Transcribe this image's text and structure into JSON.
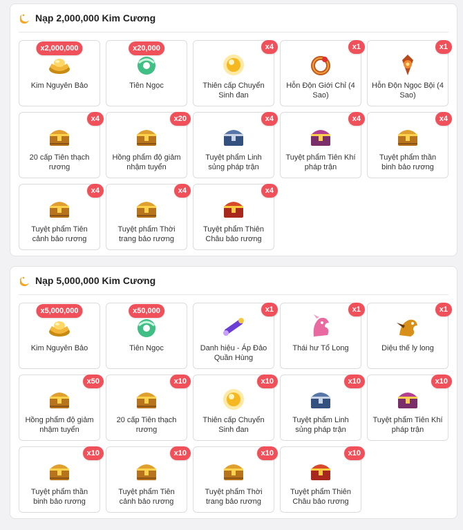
{
  "colors": {
    "badge": "#f0505a",
    "accent": "#f5a623"
  },
  "sections": [
    {
      "title": "Nạp 2,000,000 Kim Cương",
      "items": [
        {
          "name": "Kim Nguyên Bảo",
          "qty": "x2,000,000",
          "icon": "gold-ingot-icon"
        },
        {
          "name": "Tiên Ngọc",
          "qty": "x20,000",
          "icon": "jade-icon"
        },
        {
          "name": "Thiên cấp Chuyển Sinh đan",
          "qty": "x4",
          "icon": "golden-orb-icon"
        },
        {
          "name": "Hỗn Độn Giới Chỉ (4 Sao)",
          "qty": "x1",
          "icon": "ring-icon"
        },
        {
          "name": "Hỗn Độn Ngọc Bội (4 Sao)",
          "qty": "x1",
          "icon": "pendant-icon"
        },
        {
          "name": "20 cấp Tiên thạch rương",
          "qty": "x4",
          "icon": "gold-chest-icon"
        },
        {
          "name": "Hồng phẩm độ giảm nhậm tuyển",
          "qty": "x20",
          "icon": "gold-chest-icon"
        },
        {
          "name": "Tuyệt phẩm Linh sủng pháp trận",
          "qty": "x4",
          "icon": "blue-chest-icon"
        },
        {
          "name": "Tuyệt phẩm Tiên Khí pháp trận",
          "qty": "x4",
          "icon": "purple-chest-icon"
        },
        {
          "name": "Tuyệt phẩm thần binh bảo rương",
          "qty": "x4",
          "icon": "gold-chest-icon"
        },
        {
          "name": "Tuyệt phẩm Tiên cảnh bảo rương",
          "qty": "x4",
          "icon": "gold-chest-icon"
        },
        {
          "name": "Tuyệt phẩm Thời trang bảo rương",
          "qty": "x4",
          "icon": "gold-chest-icon"
        },
        {
          "name": "Tuyệt phẩm Thiên Châu bảo rương",
          "qty": "x4",
          "icon": "red-chest-icon"
        }
      ]
    },
    {
      "title": "Nạp 5,000,000 Kim Cương",
      "items": [
        {
          "name": "Kim Nguyên Bảo",
          "qty": "x5,000,000",
          "icon": "gold-ingot-icon"
        },
        {
          "name": "Tiên Ngọc",
          "qty": "x50,000",
          "icon": "jade-icon"
        },
        {
          "name": "Danh hiệu - Áp Đảo Quần Hùng",
          "qty": "x1",
          "icon": "title-scroll-icon"
        },
        {
          "name": "Thái hư Tổ Long",
          "qty": "x1",
          "icon": "dragon-pink-icon"
        },
        {
          "name": "Diệu thế ly long",
          "qty": "x1",
          "icon": "dragon-gold-icon"
        },
        {
          "name": "Hồng phẩm độ giảm nhậm tuyển",
          "qty": "x50",
          "icon": "gold-chest-icon"
        },
        {
          "name": "20 cấp Tiên thạch rương",
          "qty": "x10",
          "icon": "gold-chest-icon"
        },
        {
          "name": "Thiên cấp Chuyển Sinh đan",
          "qty": "x10",
          "icon": "golden-orb-icon"
        },
        {
          "name": "Tuyệt phẩm Linh sủng pháp trận",
          "qty": "x10",
          "icon": "blue-chest-icon"
        },
        {
          "name": "Tuyệt phẩm Tiên Khí pháp trận",
          "qty": "x10",
          "icon": "purple-chest-icon"
        },
        {
          "name": "Tuyệt phẩm thần binh bảo rương",
          "qty": "x10",
          "icon": "gold-chest-icon"
        },
        {
          "name": "Tuyệt phẩm Tiên cảnh bảo rương",
          "qty": "x10",
          "icon": "gold-chest-icon"
        },
        {
          "name": "Tuyệt phẩm Thời trang bảo rương",
          "qty": "x10",
          "icon": "gold-chest-icon"
        },
        {
          "name": "Tuyệt phẩm Thiên Châu bảo rương",
          "qty": "x10",
          "icon": "red-chest-icon"
        }
      ]
    }
  ]
}
